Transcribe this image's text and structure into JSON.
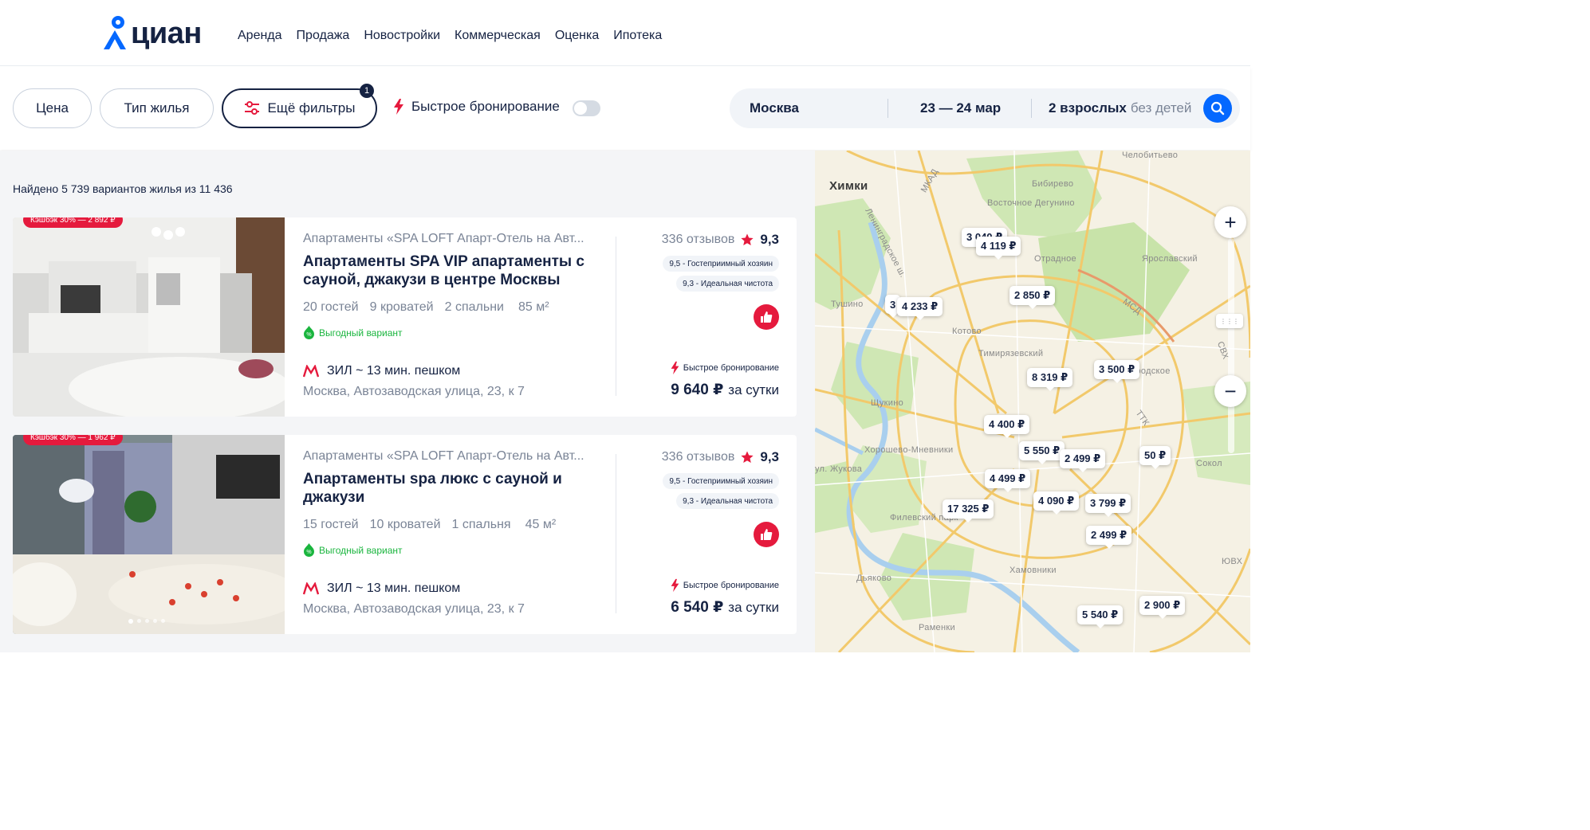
{
  "brand": {
    "name": "циан",
    "accent": "#0468ff"
  },
  "nav": [
    "Аренда",
    "Продажа",
    "Новостройки",
    "Коммерческая",
    "Оценка",
    "Ипотека"
  ],
  "filters": {
    "price": "Цена",
    "housing_type": "Тип жилья",
    "more_filters": "Ещё фильтры",
    "more_filters_count": "1",
    "quick_booking": "Быстрое бронирование",
    "quick_booking_enabled": false
  },
  "search": {
    "city": "Москва",
    "dates": "23 — 24 мар",
    "guests": "2 взрослых",
    "children": "без детей"
  },
  "results": {
    "found_text": "Найдено 5 739 вариантов жилья из 11 436"
  },
  "listings": [
    {
      "cashback": "Кэшбэк 30% — 2 892 ₽",
      "subtitle": "Апартаменты «SPA LOFT Апарт-Отель на Авт...",
      "title": "Апартаменты SPA VIP апартаменты с сауной, джакузи в центре Москвы",
      "guests": "20 гостей",
      "beds": "9 кроватей",
      "bedrooms": "2 спальни",
      "area": "85 м²",
      "good_deal": "Выгодный вариант",
      "metro": "ЗИЛ ~ 13 мин. пешком",
      "address": "Москва, Автозаводская улица, 23, к 7",
      "reviews": "336 отзывов",
      "rating": "9,3",
      "tag1": "9,5 - Гостеприимный хозяин",
      "tag2": "9,3 - Идеальная чистота",
      "quick_booking": "Быстрое бронирование",
      "price": "9 640 ₽",
      "price_unit": "за сутки"
    },
    {
      "cashback": "Кэшбэк 30% — 1 962 ₽",
      "subtitle": "Апартаменты «SPA LOFT Апарт-Отель на Авт...",
      "title": "Апартаменты spa люкс с сауной и джакузи",
      "guests": "15 гостей",
      "beds": "10 кроватей",
      "bedrooms": "1 спальня",
      "area": "45 м²",
      "good_deal": "Выгодный вариант",
      "metro": "ЗИЛ ~ 13 мин. пешком",
      "address": "Москва, Автозаводская улица, 23, к 7",
      "reviews": "336 отзывов",
      "rating": "9,3",
      "tag1": "9,5 - Гостеприимный хозяин",
      "tag2": "9,3 - Идеальная чистота",
      "quick_booking": "Быстрое бронирование",
      "price": "6 540 ₽",
      "price_unit": "за сутки"
    }
  ],
  "map": {
    "labels": [
      "Химки",
      "Челобитьево",
      "МКАД",
      "Бибирево",
      "Восточное Дегунино",
      "Отрадное",
      "Ярославский",
      "Ленинградское ш.",
      "МСД",
      "Тушино",
      "Котово",
      "Тимирязевский",
      "Богородское",
      "СВХ",
      "Щукино",
      "Хорошево-Мневники",
      "ТТК",
      "Сокол",
      "Филевский парк",
      "Хамовники",
      "Дьяково",
      "Раменки",
      "ЮВХ",
      "ул. Жукова"
    ],
    "pins": [
      "3 040 ₽",
      "4 119 ₽",
      "2 850 ₽",
      "4 233 ₽",
      "3",
      "8 319 ₽",
      "3 500 ₽",
      "4 400 ₽",
      "5 550 ₽",
      "2 499 ₽",
      "50 ₽",
      "4 499 ₽",
      "4 090 ₽",
      "3 799 ₽",
      "17 325 ₽",
      "2 499 ₽",
      "5 540 ₽",
      "2 900 ₽"
    ],
    "zoom_in": "+",
    "zoom_out": "−"
  }
}
